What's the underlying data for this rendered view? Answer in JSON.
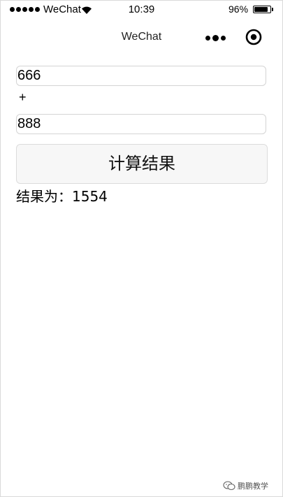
{
  "status_bar": {
    "carrier": "WeChat",
    "time": "10:39",
    "battery_percent": "96%",
    "battery_level": 0.96,
    "signal_bars": 5
  },
  "nav": {
    "title": "WeChat",
    "more_icon": "more-dots-icon",
    "close_icon": "target-close-icon"
  },
  "form": {
    "num1_value": "666",
    "operator": "+",
    "num2_value": "888",
    "button_label": "计算结果",
    "result_label": "结果为：",
    "result_value": "1554"
  },
  "watermark": {
    "text": "鹏鹏教学",
    "icon": "wechat-icon"
  }
}
